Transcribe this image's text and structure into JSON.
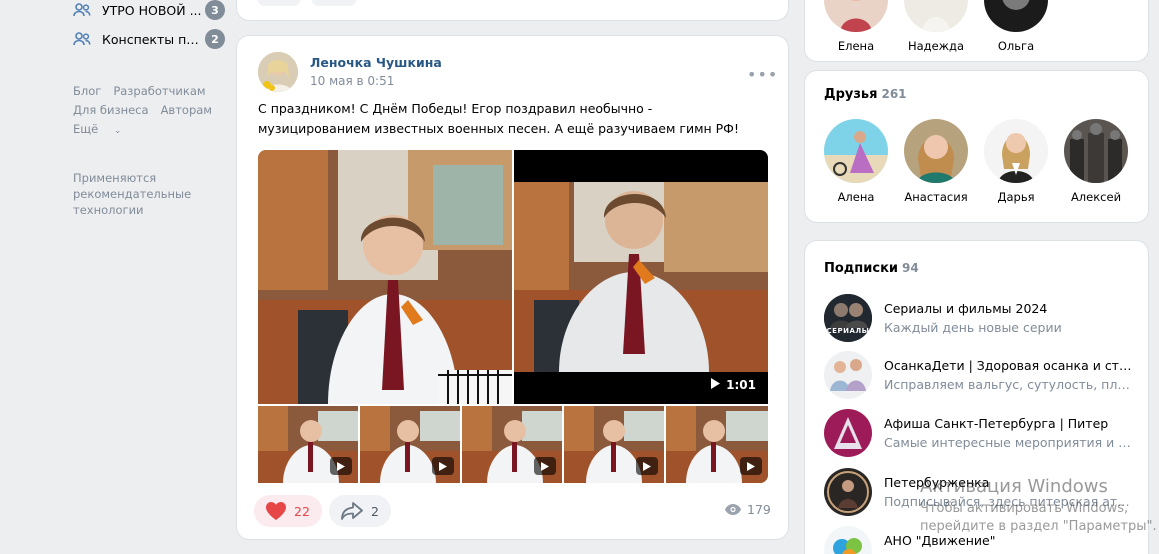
{
  "left_nav": {
    "items": [
      {
        "label": "УТРО НОВОЙ ...",
        "count": "3",
        "icon": "group-icon"
      },
      {
        "label": "Конспекты по ...",
        "count": "2",
        "icon": "group-icon"
      }
    ],
    "footer_links": [
      "Блог",
      "Разработчикам",
      "Для бизнеса",
      "Авторам",
      "Ещё"
    ],
    "footer_note": "Применяются рекомендательные технологии"
  },
  "post": {
    "author": "Леночка Чушкина",
    "date": "10 мая в 0:51",
    "text": "С праздником! С Днём Победы! Егор поздравил необычно - музицированием известных военных песен. А ещё разучиваем гимн РФ!",
    "video_duration": "1:01",
    "likes": "22",
    "shares": "2",
    "views": "179"
  },
  "right": {
    "top_friends": [
      {
        "name": "Елена"
      },
      {
        "name": "Надежда"
      },
      {
        "name": "Ольга"
      }
    ],
    "friends": {
      "title": "Друзья",
      "count": "261",
      "items": [
        {
          "name": "Алена"
        },
        {
          "name": "Анастасия"
        },
        {
          "name": "Дарья"
        },
        {
          "name": "Алексей"
        }
      ]
    },
    "subscriptions": {
      "title": "Подписки",
      "count": "94",
      "items": [
        {
          "name": "Сериалы и фильмы 2024",
          "desc": "Каждый день новые серии",
          "avatar_text": "СЕРИАЛЫ"
        },
        {
          "name": "ОсанкаДети | Здоровая осанка и стопы...",
          "desc": "Исправляем вальгус, сутулость, плоско..."
        },
        {
          "name": "Афиша Санкт-Петербурга | Питер",
          "desc": "Самые интересные мероприятия и мес..."
        },
        {
          "name": "Петербурженка",
          "desc": "Подписывайся, здесь питерская атмос..."
        },
        {
          "name": "АНО \"Движение\"",
          "desc": ""
        }
      ]
    }
  },
  "watermark": {
    "title": "Активация Windows",
    "subtitle": "Чтобы активировать Windows, перейдите в раздел \"Параметры\"."
  },
  "colors": {
    "link": "#2a5885",
    "like": "#e64646",
    "muted": "#818c99",
    "background": "#edeef0"
  }
}
